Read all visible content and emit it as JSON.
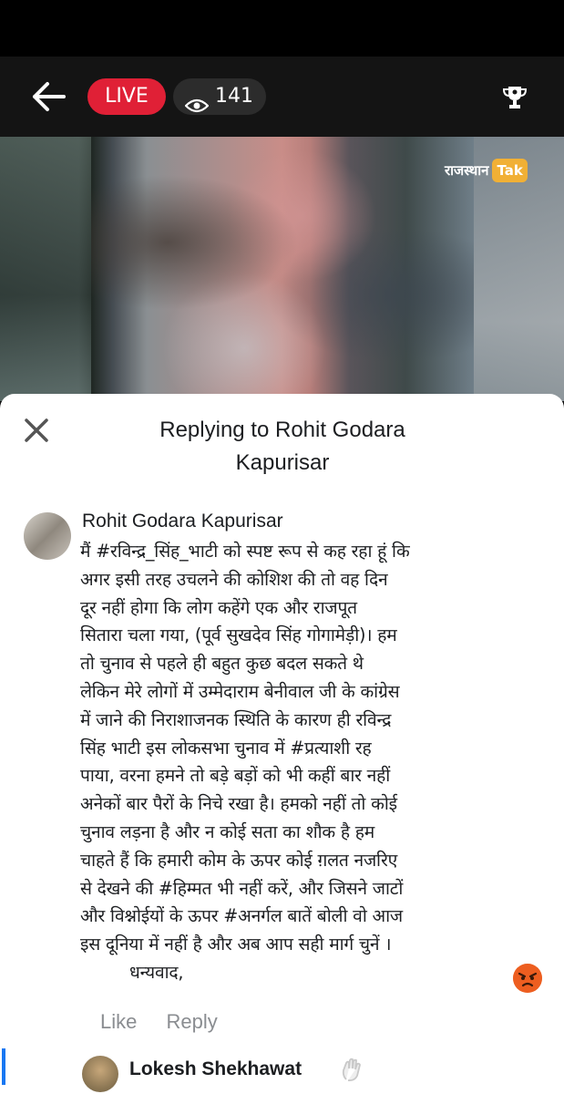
{
  "header": {
    "live_label": "LIVE",
    "viewer_count": "141",
    "icons": [
      "back-arrow-icon",
      "eye-icon",
      "trophy-icon"
    ]
  },
  "video": {
    "watermark_text": "राजस्थान",
    "watermark_badge": "Tak"
  },
  "reply_sheet": {
    "title_line1": "Replying to Rohit Godara",
    "title_line2": "Kapurisar",
    "comment": {
      "author": "Rohit Godara Kapurisar",
      "lines": [
        "मैं #रविन्द्र_सिंह_भाटी को स्पष्ट रूप से कह रहा हूं कि",
        "अगर इसी तरह उचलने की कोशिश की तो वह दिन",
        "दूर नहीं होगा कि लोग कहेंगे एक और राजपूत",
        "सितारा चला गया, (पूर्व सुखदेव सिंह गोगामेड़ी)। हम",
        "तो चुनाव से पहले ही बहुत कुछ बदल सकते थे",
        "लेकिन मेरे लोगों में उम्मेदाराम बेनीवाल जी के कांग्रेस",
        "में जाने की निराशाजनक स्थिति के कारण ही रविन्द्र",
        "सिंह भाटी इस लोकसभा चुनाव में #प्रत्याशी रह",
        "पाया, वरना हमने तो बड़े बड़ों को भी कहीं बार नहीं",
        "अनेकों बार पैरों के निचे रखा है। हमको नहीं तो कोई",
        "चुनाव लड़ना है और न कोई सता का शौक है हम",
        "चाहते हैं कि हमारी कोम के ऊपर कोई ग़लत नजरिए",
        "से देखने की #हिम्मत भी नहीं करें, और जिसने जाटों",
        "और विश्नोईयों के ऊपर #अनर्गल बातें बोली वो आज",
        "इस दूनिया में नहीं है और अब आप सही मार्ग चुनें ।"
      ],
      "thanks": "धन्यवाद,",
      "like_label": "Like",
      "reply_label": "Reply",
      "reaction": "angry-emoji"
    },
    "next_comment": {
      "author": "Lokesh Shekhawat"
    }
  }
}
